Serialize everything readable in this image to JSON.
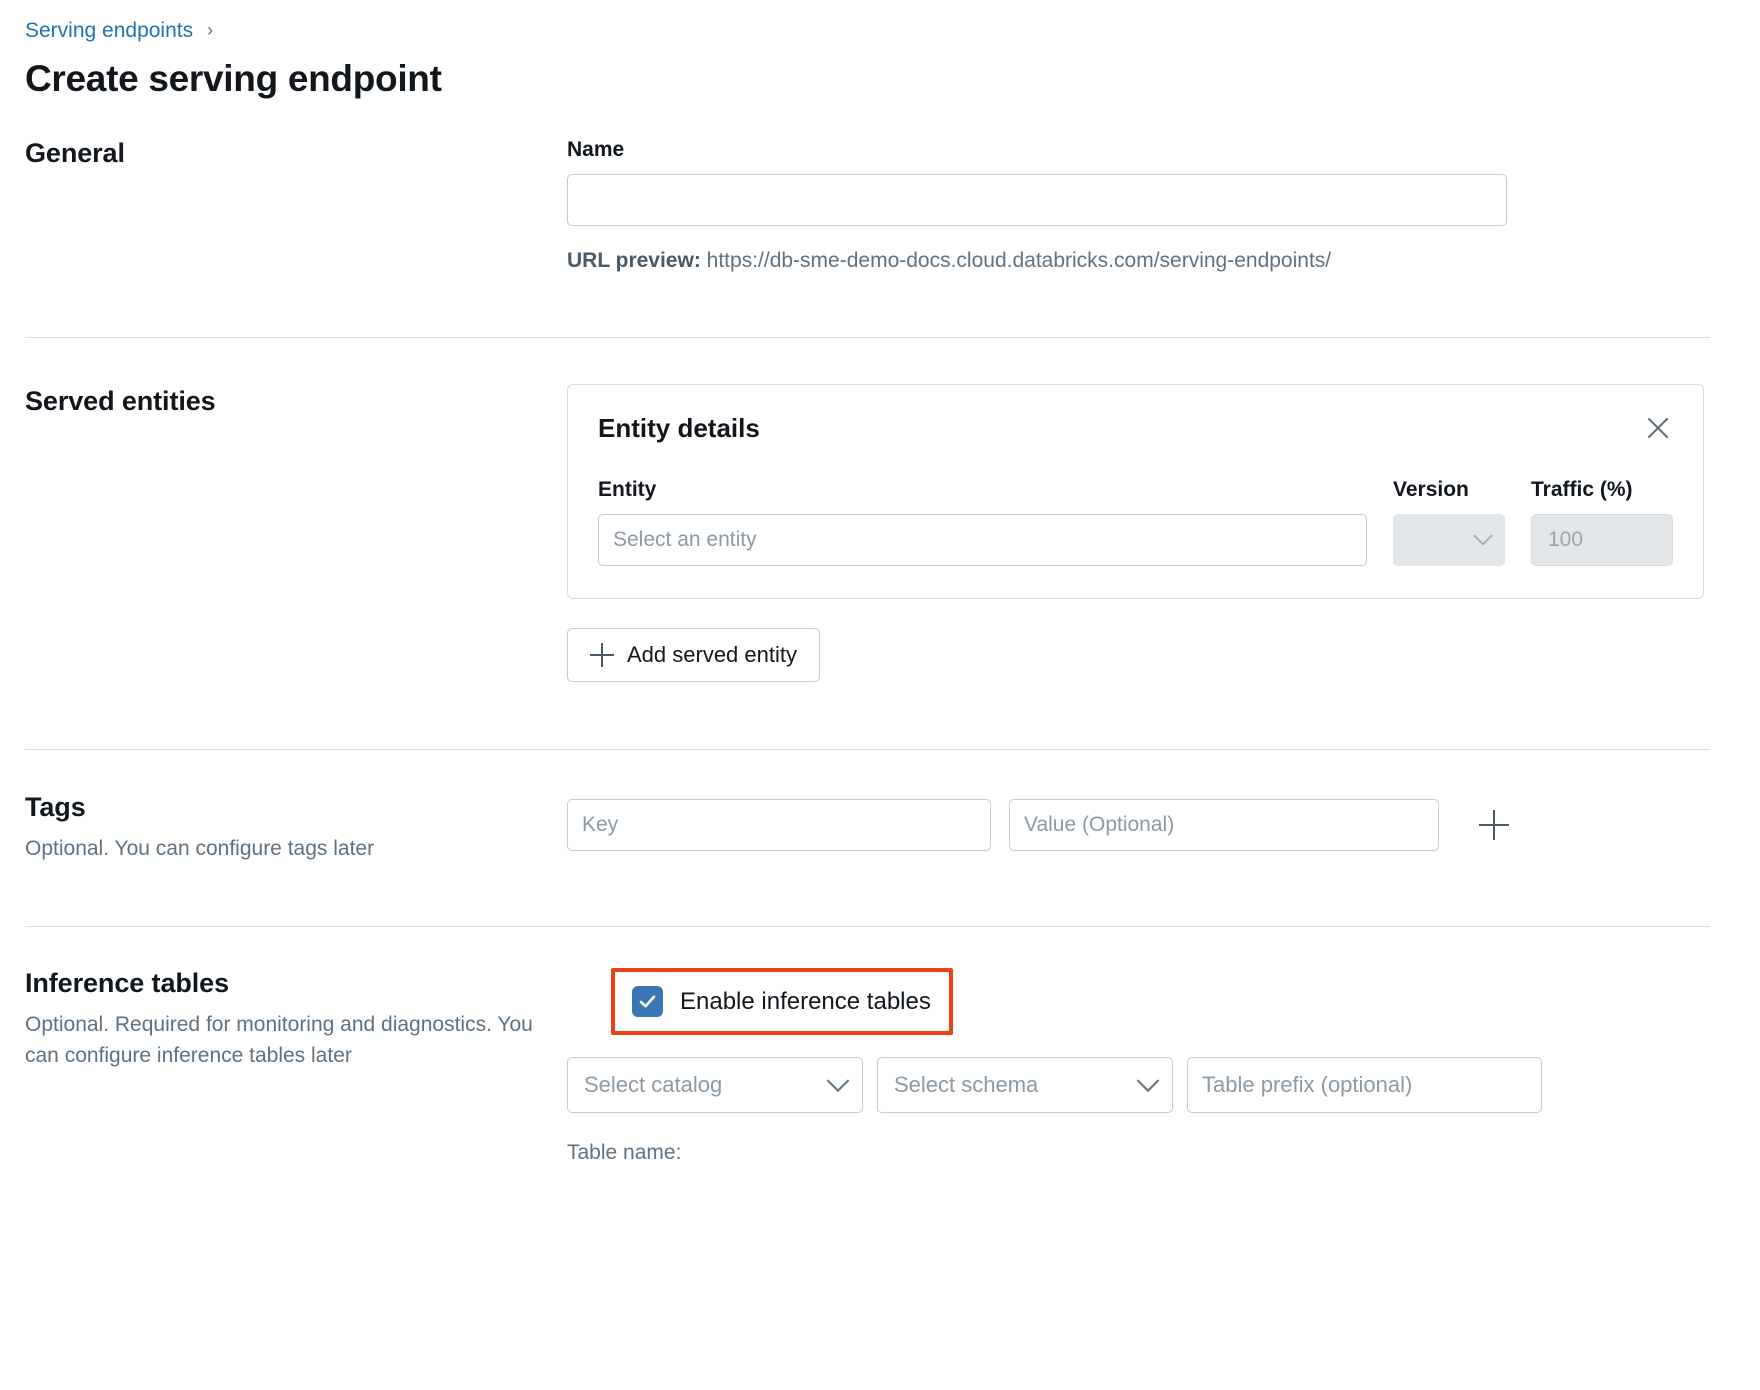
{
  "breadcrumb": {
    "link_label": "Serving endpoints",
    "separator": "›"
  },
  "page_title": "Create serving endpoint",
  "sections": {
    "general": {
      "title": "General",
      "name_label": "Name",
      "name_value": "",
      "name_placeholder": "",
      "url_preview_label": "URL preview:",
      "url_preview_value": "https://db-sme-demo-docs.cloud.databricks.com/serving-endpoints/"
    },
    "served_entities": {
      "title": "Served entities",
      "card": {
        "title": "Entity details",
        "close_icon": "close-icon",
        "columns": {
          "entity": "Entity",
          "version": "Version",
          "traffic": "Traffic (%)"
        },
        "entity_placeholder": "Select an entity",
        "entity_value": "",
        "version_value": "",
        "traffic_value": "100"
      },
      "add_button_label": "Add served entity",
      "add_button_icon": "plus-icon"
    },
    "tags": {
      "title": "Tags",
      "subtitle": "Optional. You can configure tags later",
      "key_placeholder": "Key",
      "key_value": "",
      "value_placeholder": "Value (Optional)",
      "value_value": "",
      "add_icon": "plus-icon"
    },
    "inference_tables": {
      "title": "Inference tables",
      "subtitle": "Optional. Required for monitoring and diagnostics. You can configure inference tables later",
      "checkbox_label": "Enable inference tables",
      "checkbox_checked": true,
      "catalog_placeholder": "Select catalog",
      "schema_placeholder": "Select schema",
      "prefix_placeholder": "Table prefix (optional)",
      "prefix_value": "",
      "table_name_label": "Table name:"
    }
  },
  "colors": {
    "link_blue": "#2272b4",
    "checkbox_blue": "#3a76b5",
    "highlight_red": "#ec4015",
    "border_gray": "#c0cdd8",
    "muted_text": "#5f7281"
  }
}
